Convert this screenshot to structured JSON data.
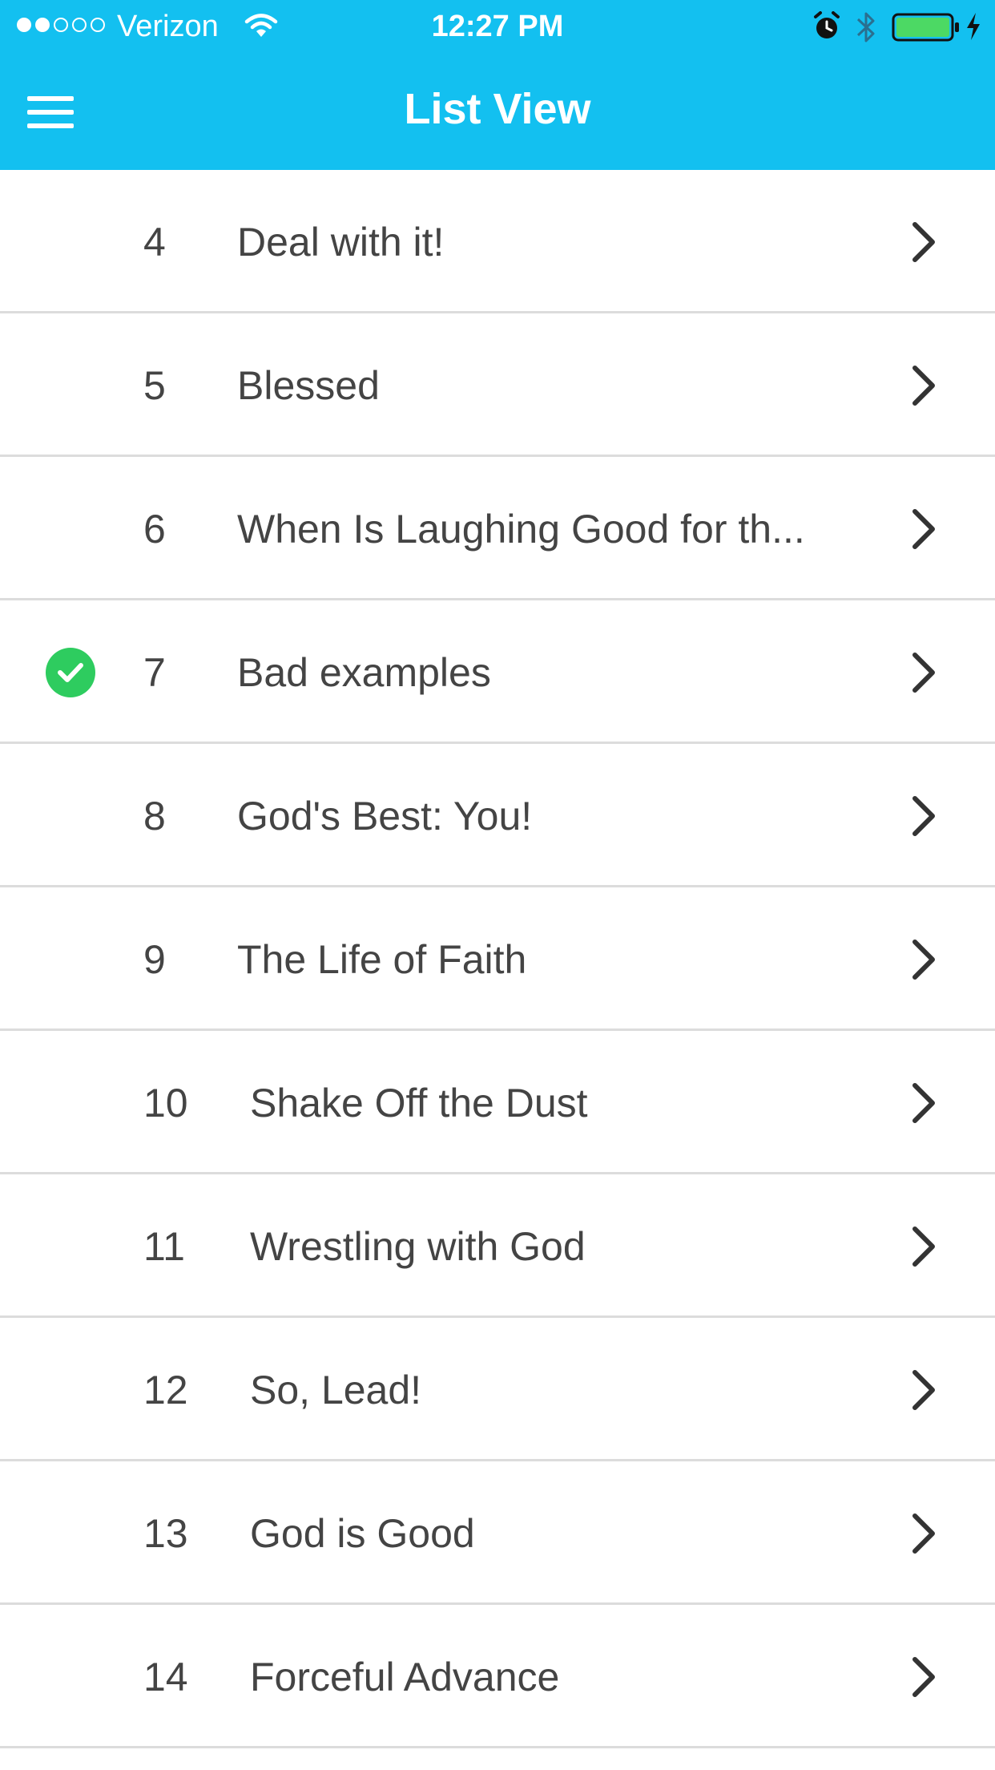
{
  "status_bar": {
    "carrier": "Verizon",
    "time": "12:27 PM",
    "signal_bars_filled": 2,
    "signal_bars_total": 5,
    "battery_color": "#4cd964",
    "icons": [
      "wifi-icon",
      "alarm-icon",
      "bluetooth-icon",
      "battery-icon",
      "charging-icon"
    ]
  },
  "nav": {
    "title": "List View",
    "menu_icon": "hamburger-menu-icon"
  },
  "colors": {
    "header_bg": "#13c0f0",
    "check_green": "#2ecc5f",
    "text": "#444444",
    "divider": "#dcdcdc"
  },
  "list": {
    "items": [
      {
        "number": "4",
        "title": "Deal with it!",
        "completed": false
      },
      {
        "number": "5",
        "title": "Blessed",
        "completed": false
      },
      {
        "number": "6",
        "title": "When Is Laughing Good for th...",
        "completed": false
      },
      {
        "number": "7",
        "title": "Bad examples",
        "completed": true
      },
      {
        "number": "8",
        "title": "God's Best: You!",
        "completed": false
      },
      {
        "number": "9",
        "title": "The Life of Faith",
        "completed": false
      },
      {
        "number": "10",
        "title": "Shake Off the Dust",
        "completed": false
      },
      {
        "number": "11",
        "title": "Wrestling with God",
        "completed": false
      },
      {
        "number": "12",
        "title": "So, Lead!",
        "completed": false
      },
      {
        "number": "13",
        "title": "God is Good",
        "completed": false
      },
      {
        "number": "14",
        "title": "Forceful Advance",
        "completed": false
      }
    ]
  }
}
